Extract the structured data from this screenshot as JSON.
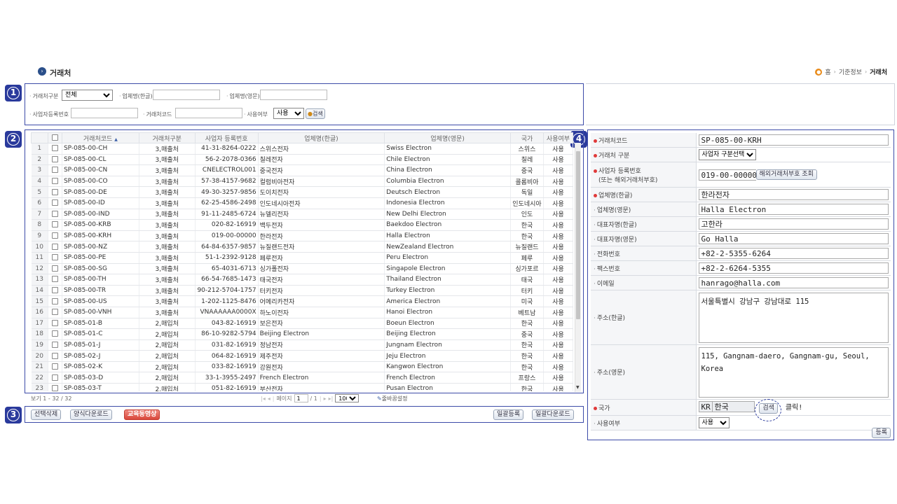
{
  "header": {
    "title": "거래처",
    "title_icon": "chevron-right-icon",
    "breadcrumb": [
      "홈",
      "기준정보",
      "거래처"
    ]
  },
  "badges": [
    "1",
    "2",
    "3",
    "4"
  ],
  "search": {
    "type_label": "거래처구분",
    "type_value": "전체",
    "name_kr_label": "업체명(한글)",
    "name_kr_value": "",
    "name_en_label": "업체명(영문)",
    "name_en_value": "",
    "bizno_label": "사업자등록번호",
    "bizno_value": "",
    "code_label": "거래처코드",
    "code_value": "",
    "use_label": "사용여부",
    "use_value": "사용",
    "search_button": "검색"
  },
  "grid": {
    "columns": [
      "거래처코드",
      "거래처구분",
      "사업자 등록번호",
      "업체명(한글)",
      "업체명(영문)",
      "국가",
      "사용여부"
    ],
    "sort_indicator": "▲",
    "rows": [
      [
        "1",
        "SP-085-00-CH",
        "3,매출처",
        "41-31-8264-0222",
        "스위스전자",
        "Swiss Electron",
        "스위스",
        "사용"
      ],
      [
        "2",
        "SP-085-00-CL",
        "3,매출처",
        "56-2-2078-0366",
        "칠레전자",
        "Chile Electron",
        "칠레",
        "사용"
      ],
      [
        "3",
        "SP-085-00-CN",
        "3,매출처",
        "CNELECTROL001",
        "중국전자",
        "China Electron",
        "중국",
        "사용"
      ],
      [
        "4",
        "SP-085-00-CO",
        "3,매출처",
        "57-38-4157-9682",
        "컬럼비아전자",
        "Columbia Electron",
        "콜롬비아",
        "사용"
      ],
      [
        "5",
        "SP-085-00-DE",
        "3,매출처",
        "49-30-3257-9856",
        "도이치전자",
        "Deutsch Electron",
        "독일",
        "사용"
      ],
      [
        "6",
        "SP-085-00-ID",
        "3,매출처",
        "62-25-4586-2498",
        "인도네시아전자",
        "Indonesia Electron",
        "인도네시아",
        "사용"
      ],
      [
        "7",
        "SP-085-00-IND",
        "3,매출처",
        "91-11-2485-6724",
        "뉴델리전자",
        "New Delhi Electron",
        "인도",
        "사용"
      ],
      [
        "8",
        "SP-085-00-KRB",
        "3,매출처",
        "020-82-16919",
        "백두전자",
        "Baekdoo Electron",
        "한국",
        "사용"
      ],
      [
        "9",
        "SP-085-00-KRH",
        "3,매출처",
        "019-00-00000",
        "한라전자",
        "Halla Electron",
        "한국",
        "사용"
      ],
      [
        "10",
        "SP-085-00-NZ",
        "3,매출처",
        "64-84-6357-9857",
        "뉴질랜드전자",
        "NewZealand Electron",
        "뉴질랜드",
        "사용"
      ],
      [
        "11",
        "SP-085-00-PE",
        "3,매출처",
        "51-1-2392-9128",
        "페루전자",
        "Peru  Electron",
        "페루",
        "사용"
      ],
      [
        "12",
        "SP-085-00-SG",
        "3,매출처",
        "65-4031-6713",
        "싱가폴전자",
        "Singapole Electron",
        "싱가포르",
        "사용"
      ],
      [
        "13",
        "SP-085-00-TH",
        "3,매출처",
        "66-54-7685-1473",
        "태국전자",
        "Thailand Electron",
        "태국",
        "사용"
      ],
      [
        "14",
        "SP-085-00-TR",
        "3,매출처",
        "90-212-5704-1757",
        "터키전자",
        "Turkey  Electron",
        "터키",
        "사용"
      ],
      [
        "15",
        "SP-085-00-US",
        "3,매출처",
        "1-202-1125-8476",
        "어메리카전자",
        "America Electron",
        "미국",
        "사용"
      ],
      [
        "16",
        "SP-085-00-VNH",
        "3,매출처",
        "VNAAAAAA0000X",
        "하노이전자",
        "Hanoi Electron",
        "베트남",
        "사용"
      ],
      [
        "17",
        "SP-085-01-B",
        "2,매입처",
        "043-82-16919",
        "보은전자",
        "Boeun Electron",
        "한국",
        "사용"
      ],
      [
        "18",
        "SP-085-01-C",
        "2,매입처",
        "86-10-9282-5794",
        "Beijing Electron",
        "Beijing Electron",
        "중국",
        "사용"
      ],
      [
        "19",
        "SP-085-01-J",
        "2,매입처",
        "031-82-16919",
        "정남전자",
        "Jungnam Electron",
        "한국",
        "사용"
      ],
      [
        "20",
        "SP-085-02-J",
        "2,매입처",
        "064-82-16919",
        "제주전자",
        "Jeju Electron",
        "한국",
        "사용"
      ],
      [
        "21",
        "SP-085-02-K",
        "2,매입처",
        "033-82-16919",
        "강원전자",
        "Kangwon Electron",
        "한국",
        "사용"
      ],
      [
        "22",
        "SP-085-03-D",
        "2,매입처",
        "33-1-3955-2497",
        "French Electron",
        "French Electron",
        "프랑스",
        "사용"
      ],
      [
        "23",
        "SP-085-03-T",
        "2,매입처",
        "051-82-16919",
        "부산전자",
        "Pusan Electron",
        "한국",
        "사용"
      ]
    ]
  },
  "pager": {
    "view_text": "보기 1 - 32 / 32",
    "page_label": "페이지",
    "page_value": "1",
    "total_pages": "/ 1",
    "rows_value": "100",
    "wrap_setting": "줄바꿈설정"
  },
  "actions": {
    "delete_selected": "선택삭제",
    "form_download": "양식다운로드",
    "tutorial_video": "교육동영상",
    "bulk_register": "일괄등록",
    "bulk_download": "일괄다운로드"
  },
  "form": {
    "code_label": "거래처코드",
    "code_value": "SP-085-00-KRH",
    "type_label": "거래처 구분",
    "type_value": "사업자 구분선택",
    "bizno_label": "사업자 등록번호",
    "bizno_sublabel": "(또는 해외거래처부호)",
    "bizno_value": "019-00-00000",
    "bizno_lookup_button": "해외거래처부호 조회",
    "name_kr_label": "업체명(한글)",
    "name_kr_value": "한라전자",
    "name_en_label": "업체명(영문)",
    "name_en_value": "Halla Electron",
    "rep_kr_label": "대표자명(한글)",
    "rep_kr_value": "고한라",
    "rep_en_label": "대표자명(영문)",
    "rep_en_value": "Go Halla",
    "phone_label": "전화번호",
    "phone_value": "+82-2-5355-6264",
    "fax_label": "팩스번호",
    "fax_value": "+82-2-6264-5355",
    "email_label": "이메일",
    "email_value": "hanrago@halla.com",
    "addr_kr_label": "주소(한글)",
    "addr_kr_value": "서울특별시 강남구 강남대로 115",
    "addr_en_label": "주소(영문)",
    "addr_en_value": "115, Gangnam-daero, Gangnam-gu, Seoul, Korea",
    "country_label": "국가",
    "country_code": "KR",
    "country_name": "한국",
    "country_search_button": "검색",
    "click_note": "클릭!",
    "use_label": "사용여부",
    "use_value": "사용",
    "register_button": "등록"
  },
  "colors": {
    "badge": "#2a3a9c",
    "panel_border": "#3c4ba8",
    "required_dot": "#e03a3a",
    "tutorial_button": "#d9473b"
  }
}
